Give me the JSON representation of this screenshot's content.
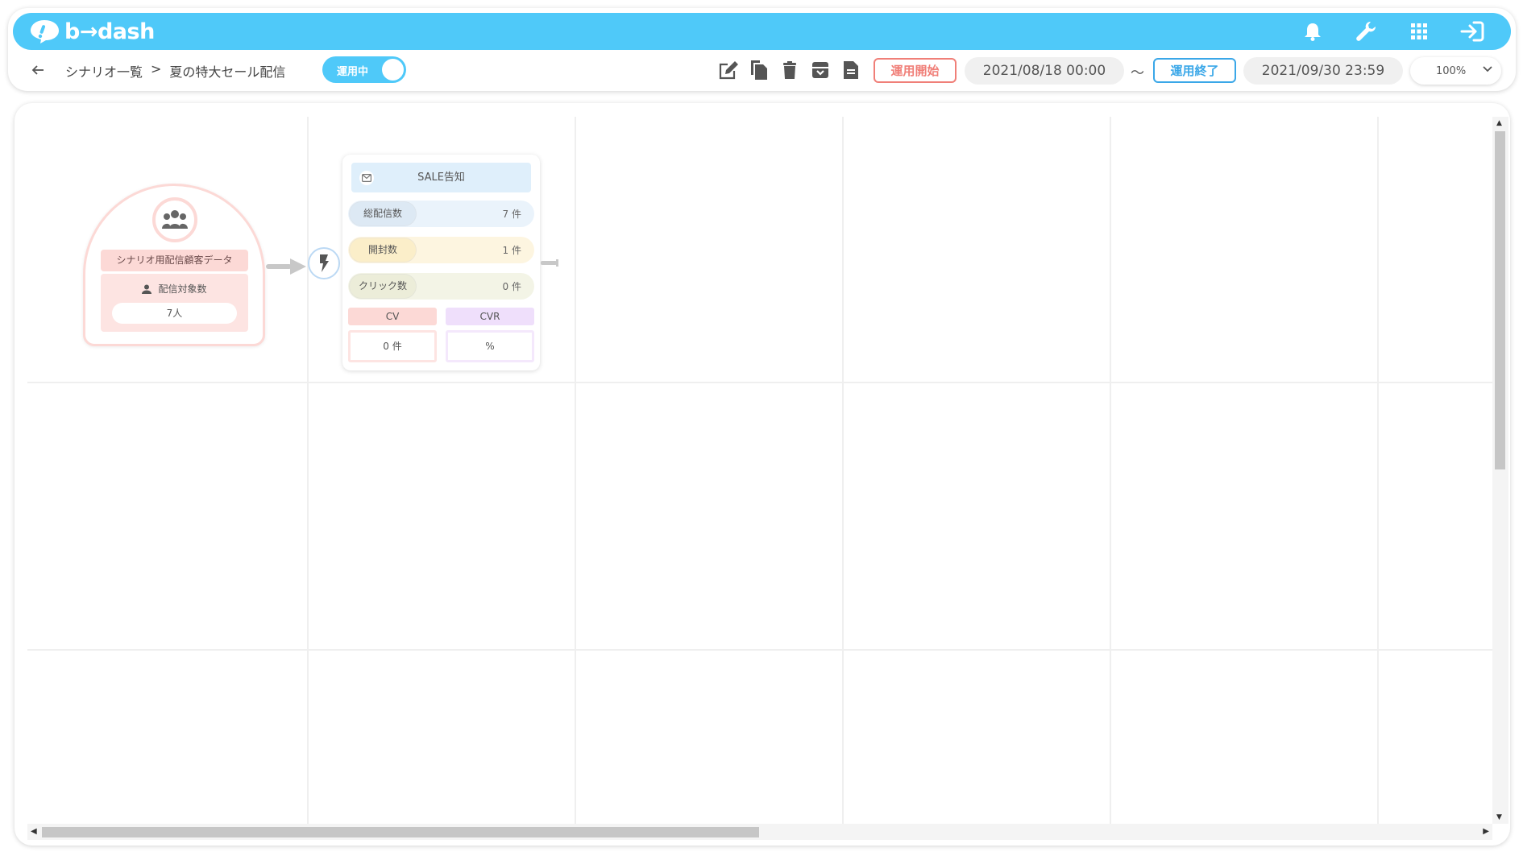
{
  "app": {
    "logo_text": "b→dash"
  },
  "header": {
    "breadcrumb": {
      "parent": "シナリオ一覧",
      "separator": ">",
      "current": "夏の特大セール配信"
    },
    "status_toggle": {
      "label": "運用中",
      "on": true
    },
    "start_button": "運用開始",
    "start_date": "2021/08/18 00:00",
    "tilde": "〜",
    "end_button": "運用終了",
    "end_date": "2021/09/30 23:59",
    "zoom": "100%"
  },
  "segment_node": {
    "title": "シナリオ用配信顧客データ",
    "target_label": "配信対象数",
    "target_value": "7人"
  },
  "mail_node": {
    "title": "SALE告知",
    "stats": [
      {
        "label": "総配信数",
        "value": "7 件"
      },
      {
        "label": "開封数",
        "value": "1 件"
      },
      {
        "label": "クリック数",
        "value": "0 件"
      }
    ],
    "cv_label": "CV",
    "cvr_label": "CVR",
    "cv_value": "0 件",
    "cvr_value": "%"
  },
  "colors": {
    "accent": "#4fc9f9",
    "start": "#f07f78",
    "end": "#3aa7e8"
  }
}
